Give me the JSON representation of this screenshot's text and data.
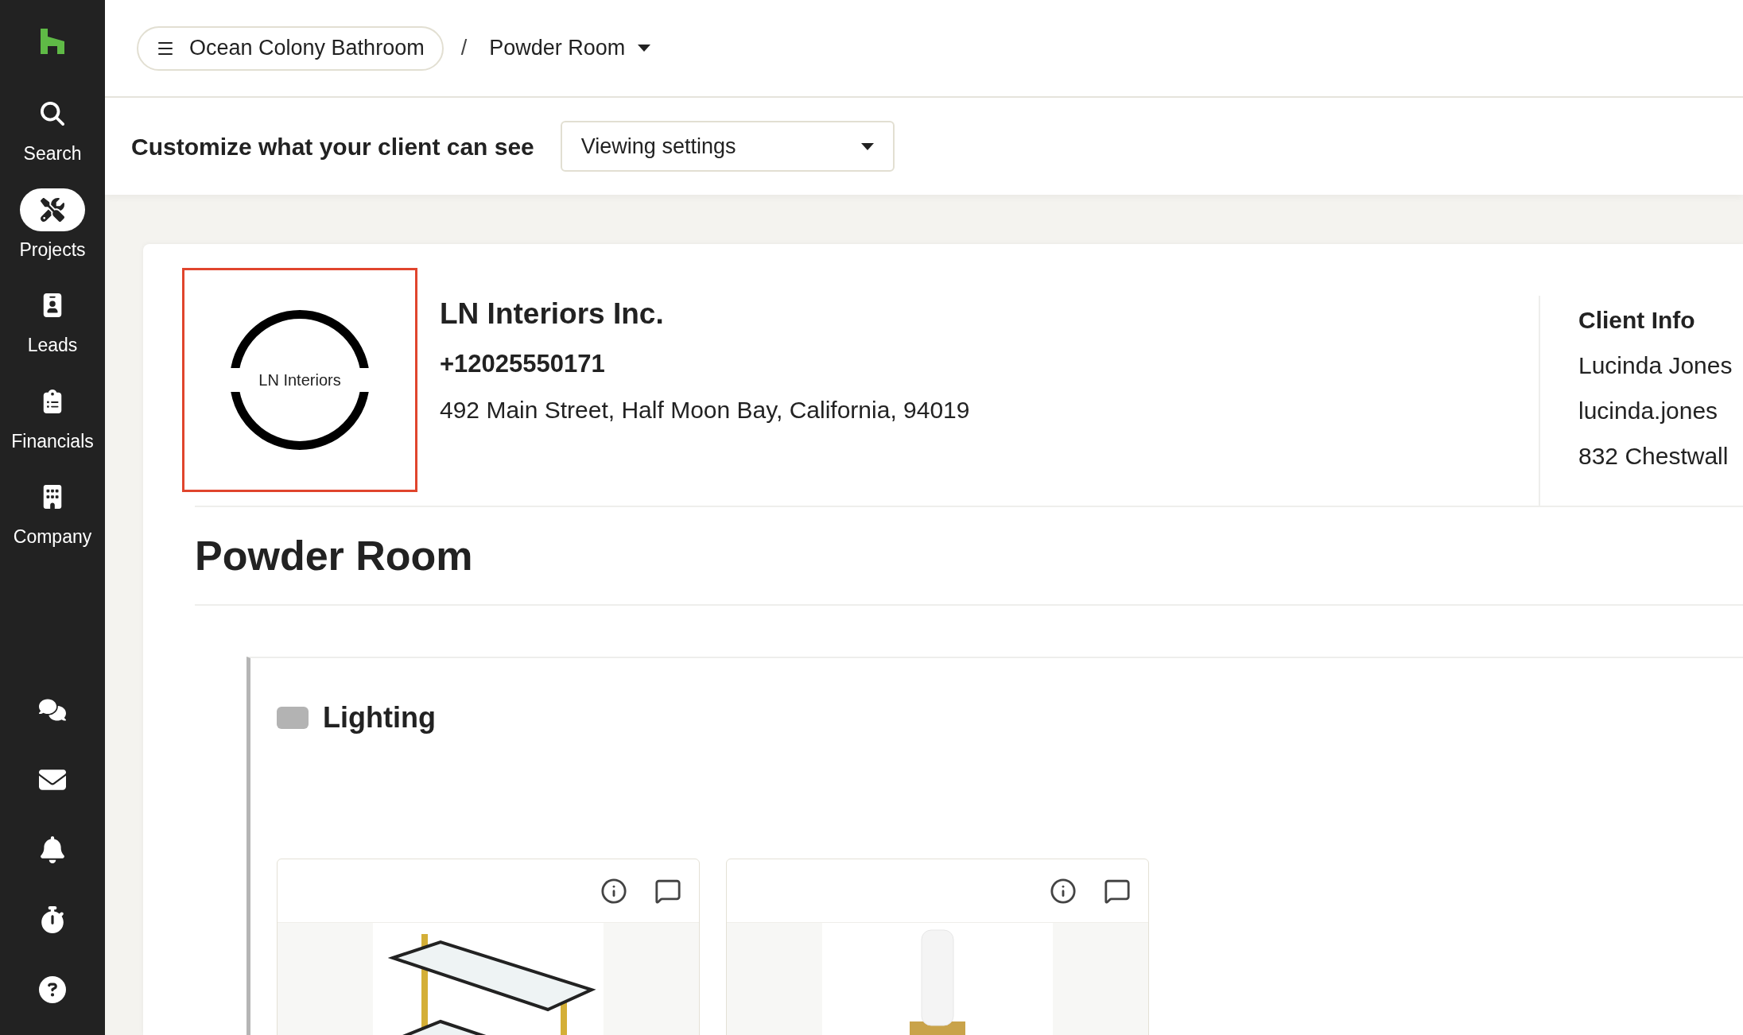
{
  "sidebar": {
    "items": [
      {
        "kind": "search",
        "label": "Search",
        "selected": false
      },
      {
        "kind": "projects",
        "label": "Projects",
        "selected": true
      },
      {
        "kind": "leads",
        "label": "Leads",
        "selected": false
      },
      {
        "kind": "financials",
        "label": "Financials",
        "selected": false
      },
      {
        "kind": "company",
        "label": "Company",
        "selected": false
      }
    ],
    "bottom_icons": [
      {
        "kind": "messages"
      },
      {
        "kind": "inbox"
      },
      {
        "kind": "notifications"
      },
      {
        "kind": "timer"
      },
      {
        "kind": "help"
      }
    ]
  },
  "breadcrumb": {
    "project": "Ocean Colony Bathroom",
    "separator": "/",
    "room": "Powder Room"
  },
  "toolbar": {
    "label": "Customize what your client can see",
    "dropdown": "Viewing settings"
  },
  "company": {
    "logo_text": "LN Interiors",
    "name": "LN Interiors Inc.",
    "phone": "+12025550171",
    "address": "492 Main Street, Half Moon Bay, California, 94019"
  },
  "client_info": {
    "title": "Client Info",
    "lines": [
      "Lucinda Jones",
      "lucinda.jones",
      "832 Chestwall"
    ]
  },
  "room": {
    "title": "Powder Room"
  },
  "section": {
    "title": "Lighting",
    "color": "#b3b3b3",
    "products": [
      {
        "kind": "shelf"
      },
      {
        "kind": "sconce"
      }
    ]
  }
}
